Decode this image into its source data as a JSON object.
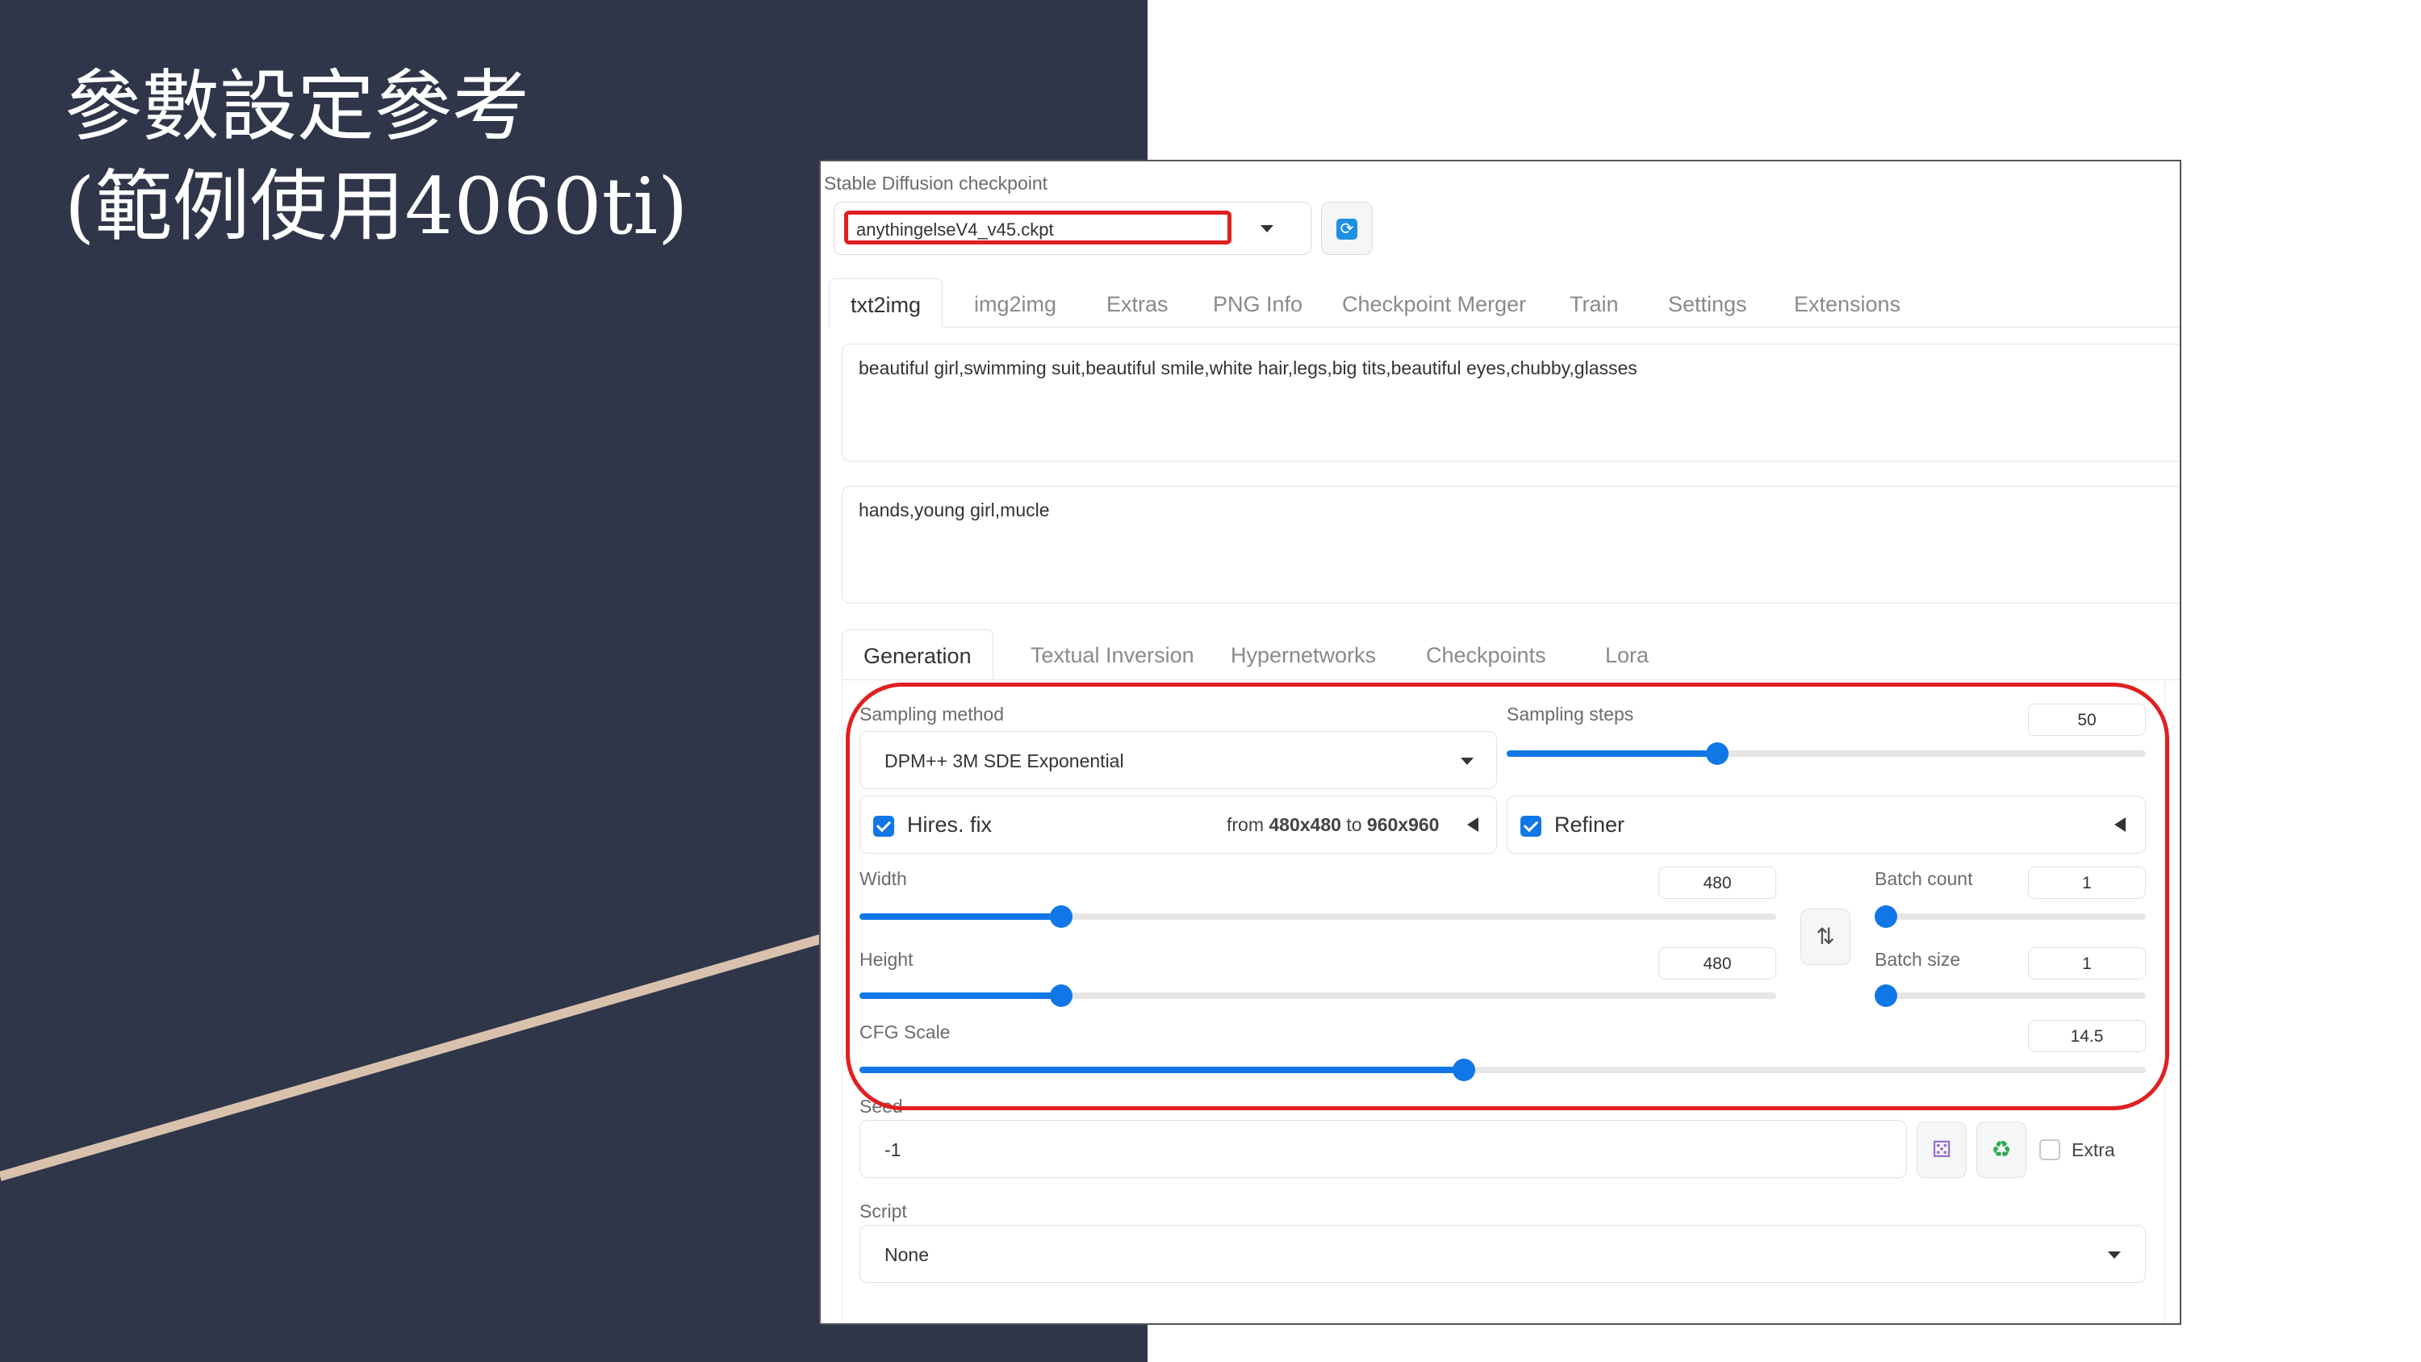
{
  "slide": {
    "title_line1": "參數設定參考",
    "title_line2": "(範例使用4060ti)"
  },
  "checkpoint": {
    "label": "Stable Diffusion checkpoint",
    "value": "anythingelseV4_v45.ckpt",
    "refresh_icon": "refresh-icon"
  },
  "main_tabs": [
    "txt2img",
    "img2img",
    "Extras",
    "PNG Info",
    "Checkpoint Merger",
    "Train",
    "Settings",
    "Extensions"
  ],
  "prompt": {
    "positive": "beautiful girl,swimming suit,beautiful smile,white hair,legs,big tits,beautiful eyes,chubby,glasses",
    "negative": "hands,young girl,mucle"
  },
  "gen_tabs": [
    "Generation",
    "Textual Inversion",
    "Hypernetworks",
    "Checkpoints",
    "Lora"
  ],
  "generation": {
    "sampling_method": {
      "label": "Sampling method",
      "value": "DPM++ 3M SDE Exponential"
    },
    "sampling_steps": {
      "label": "Sampling steps",
      "value": "50",
      "fraction": 0.33
    },
    "hires": {
      "label": "Hires. fix",
      "checked": true,
      "from_prefix": "from",
      "from_value": "480x480",
      "to_prefix": "to",
      "to_value": "960x960"
    },
    "refiner": {
      "label": "Refiner",
      "checked": true
    },
    "width": {
      "label": "Width",
      "value": "480",
      "fraction": 0.22
    },
    "height": {
      "label": "Height",
      "value": "480",
      "fraction": 0.22
    },
    "swap_icon": "swap-vertical-icon",
    "batch_count": {
      "label": "Batch count",
      "value": "1",
      "fraction": 0.0
    },
    "batch_size": {
      "label": "Batch size",
      "value": "1",
      "fraction": 0.0
    },
    "cfg_scale": {
      "label": "CFG Scale",
      "value": "14.5",
      "fraction": 0.47
    },
    "seed": {
      "label": "Seed",
      "value": "-1",
      "dice_icon": "dice-icon",
      "recycle_icon": "recycle-icon",
      "extra_label": "Extra",
      "extra_checked": false
    },
    "script": {
      "label": "Script",
      "value": "None"
    }
  },
  "colors": {
    "slide_bg": "#2f3649",
    "accent_line": "#d9c2ad",
    "slider_blue": "#1177e6",
    "highlight_red": "#e02020"
  }
}
